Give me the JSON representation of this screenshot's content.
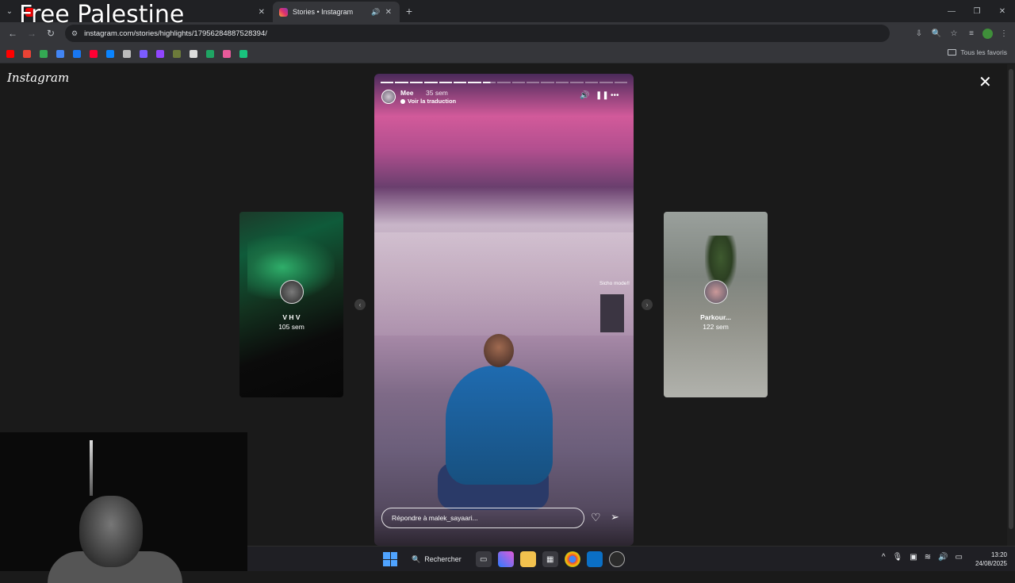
{
  "overlay": {
    "title": "Free Palestine"
  },
  "browser": {
    "tabs": [
      {
        "title": "",
        "active": false
      },
      {
        "title": "Stories • Instagram",
        "active": true
      }
    ],
    "url": "instagram.com/stories/highlights/17956284887528394/",
    "bookmarks_all_label": "Tous les favoris"
  },
  "page": {
    "logo": "Instagram",
    "left_story": {
      "name": "V H V",
      "time": "105 sem"
    },
    "right_story": {
      "name": "Parkour...",
      "time": "122 sem"
    },
    "story": {
      "username": "Mee",
      "time": "35 sem",
      "translate_label": "Voir la traduction",
      "caption": "Sicho mode!!",
      "reply_placeholder": "Répondre à malek_sayaari..."
    }
  },
  "taskbar": {
    "search_label": "Rechercher",
    "time": "13:20",
    "date": "24/08/2025"
  },
  "colors": {
    "instagram_accent": "#e1306c",
    "windows_blue": "#4fa3ff",
    "browser_dark": "#202124"
  }
}
